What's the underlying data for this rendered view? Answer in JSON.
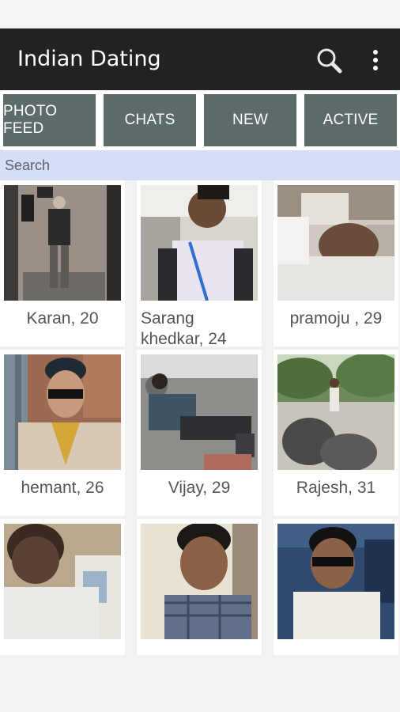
{
  "app": {
    "title": "Indian Dating"
  },
  "toolbar": {
    "search_icon": "search-icon",
    "more_icon": "more-vert-icon"
  },
  "tabs": [
    {
      "label": "PHOTO FEED"
    },
    {
      "label": "CHATS"
    },
    {
      "label": "NEW"
    },
    {
      "label": "ACTIVE"
    }
  ],
  "search": {
    "placeholder": "Search"
  },
  "profiles": [
    {
      "caption": "Karan, 20"
    },
    {
      "caption": "Sarang khedkar, 24"
    },
    {
      "caption": "pramoju , 29"
    },
    {
      "caption": "hemant, 26"
    },
    {
      "caption": "Vijay, 29"
    },
    {
      "caption": "Rajesh, 31"
    },
    {
      "caption": ""
    },
    {
      "caption": ""
    },
    {
      "caption": ""
    }
  ],
  "colors": {
    "app_bar": "#222222",
    "tab_bg": "#5d6b6a",
    "search_bg": "#d5def5"
  }
}
